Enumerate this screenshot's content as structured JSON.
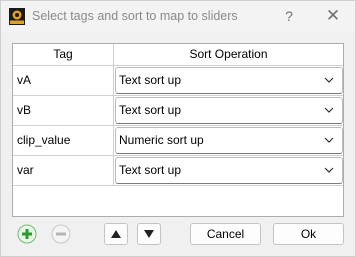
{
  "window": {
    "title": "Select tags and sort to map to sliders",
    "help_label": "?",
    "close_label": "✕",
    "app_icon": "darktable-logo-icon"
  },
  "table": {
    "columns": [
      "Tag",
      "Sort Operation"
    ],
    "rows": [
      {
        "tag": "vA",
        "sort": "Text sort up"
      },
      {
        "tag": "vB",
        "sort": "Text sort up"
      },
      {
        "tag": "clip_value",
        "sort": "Numeric sort up"
      },
      {
        "tag": "var",
        "sort": "Text sort up"
      }
    ]
  },
  "buttons": {
    "add_icon": "plus-icon",
    "remove_icon": "minus-icon",
    "up_icon": "arrow-up-icon",
    "down_icon": "arrow-down-icon",
    "cancel_label": "Cancel",
    "ok_label": "Ok"
  },
  "colors": {
    "add_green": "#3aa33a",
    "disabled_gray": "#b5b5b5"
  }
}
